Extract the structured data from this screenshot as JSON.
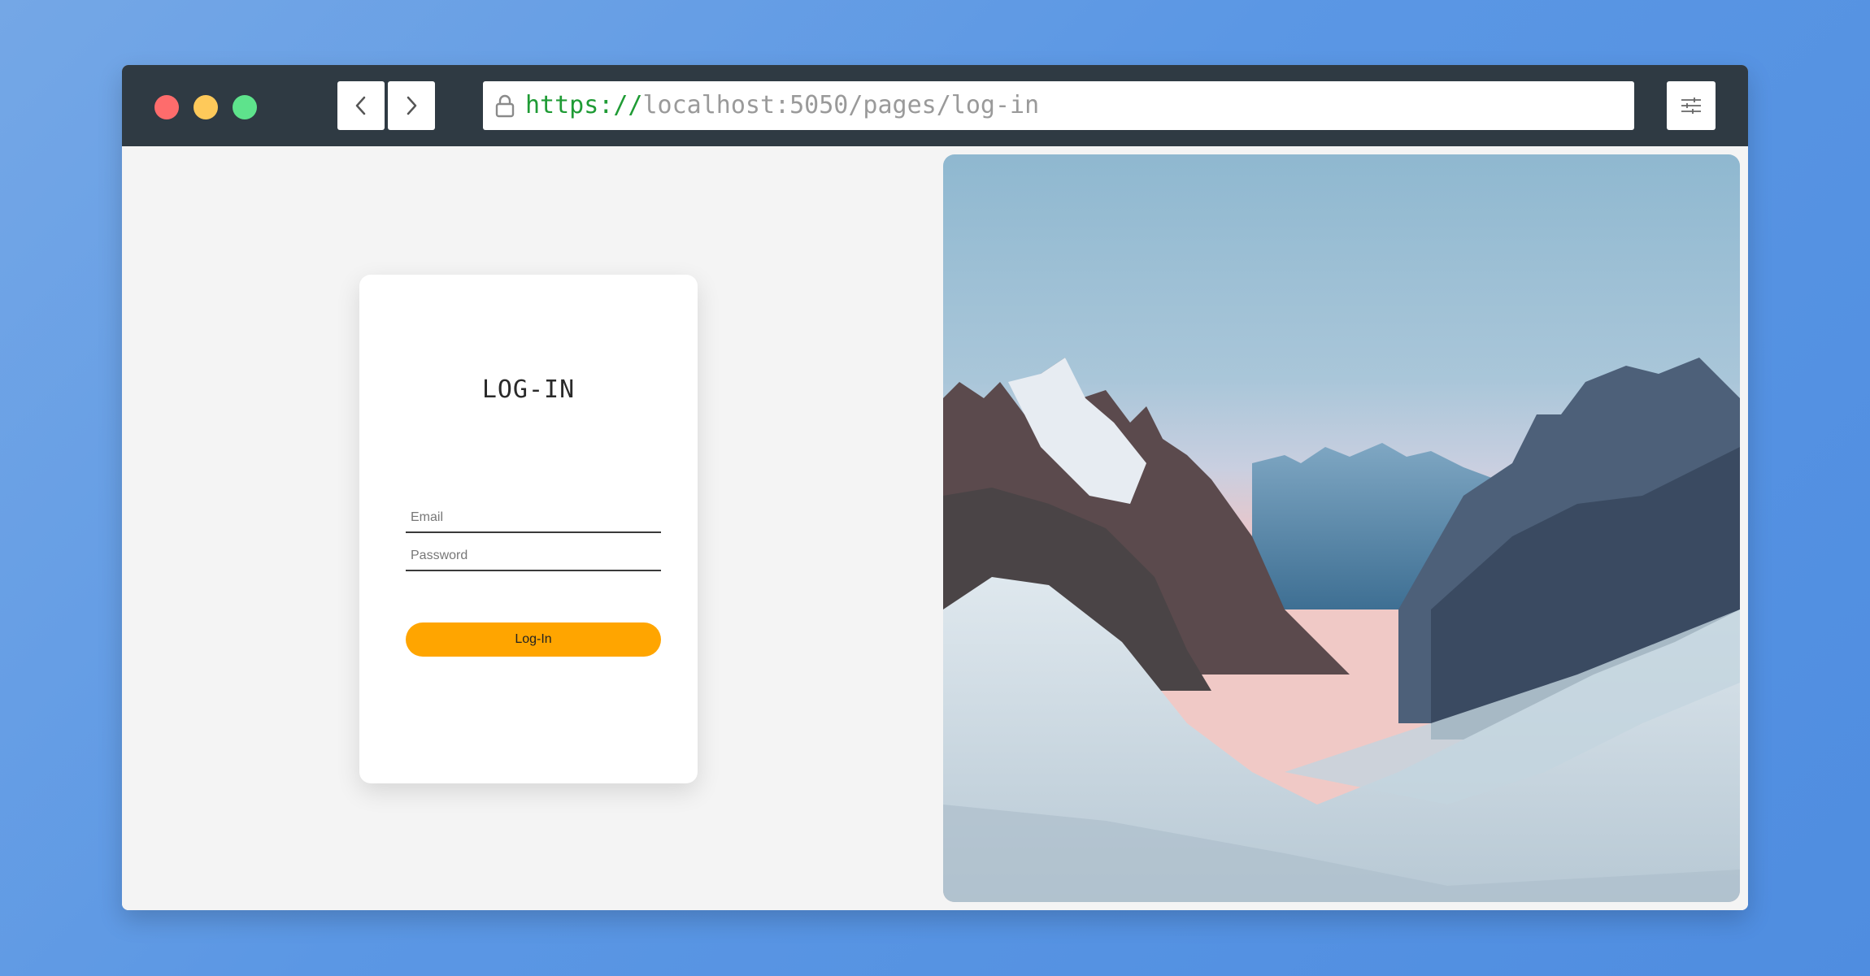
{
  "browser": {
    "url_scheme": "https://",
    "url_rest": "localhost:5050/pages/log-in"
  },
  "login": {
    "title": "LOG-IN",
    "email_placeholder": "Email",
    "password_placeholder": "Password",
    "button_label": "Log-In"
  },
  "colors": {
    "accent": "#ffa500",
    "titlebar": "#2f3a43",
    "dot_close": "#fe6c6c",
    "dot_minimize": "#fec95a",
    "dot_maximize": "#5ee38c",
    "url_scheme": "#1f9b35"
  },
  "icons": {
    "back": "chevron-left-icon",
    "forward": "chevron-right-icon",
    "lock": "lock-icon",
    "settings": "sliders-icon"
  }
}
